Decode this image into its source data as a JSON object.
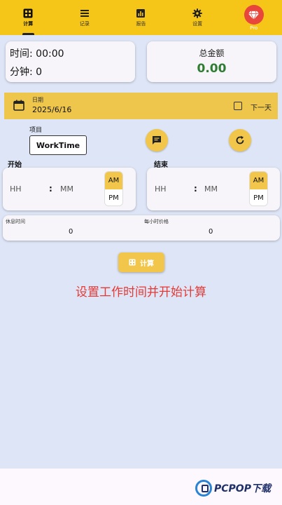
{
  "nav": {
    "items": [
      {
        "label": "计算",
        "icon": "calculator-icon",
        "active": true
      },
      {
        "label": "记录",
        "icon": "list-icon",
        "active": false
      },
      {
        "label": "报告",
        "icon": "bar-chart-icon",
        "active": false
      },
      {
        "label": "设置",
        "icon": "gear-icon",
        "active": false
      },
      {
        "label": "Pro",
        "icon": "diamond-icon",
        "active": false
      }
    ]
  },
  "time_card": {
    "time_label": "时间: 00:00",
    "minutes_label": "分钟: 0"
  },
  "total_card": {
    "label": "总金额",
    "value": "0.00"
  },
  "date_bar": {
    "small_label": "日期",
    "value": "2025/6/16",
    "next_day_label": "下一天",
    "next_day_checked": false
  },
  "project": {
    "label": "项目",
    "value": "WorkTime"
  },
  "start": {
    "label": "开始",
    "hh_placeholder": "HH",
    "mm_placeholder": "MM",
    "am": "AM",
    "pm": "PM"
  },
  "end": {
    "label": "结束",
    "hh_placeholder": "HH",
    "mm_placeholder": "MM",
    "am": "AM",
    "pm": "PM"
  },
  "rest": {
    "rest_label": "休息时间",
    "rest_value": "0",
    "price_label": "每小时价格",
    "price_value": "0"
  },
  "calc_button": {
    "label": "计算"
  },
  "hint": "设置工作时间并开始计算",
  "watermark": {
    "text": "PCPOP下载"
  },
  "colors": {
    "accent": "#f5c518",
    "total_green": "#2e7d32",
    "hint_red": "#e53935",
    "pro_red": "#e8453c"
  }
}
